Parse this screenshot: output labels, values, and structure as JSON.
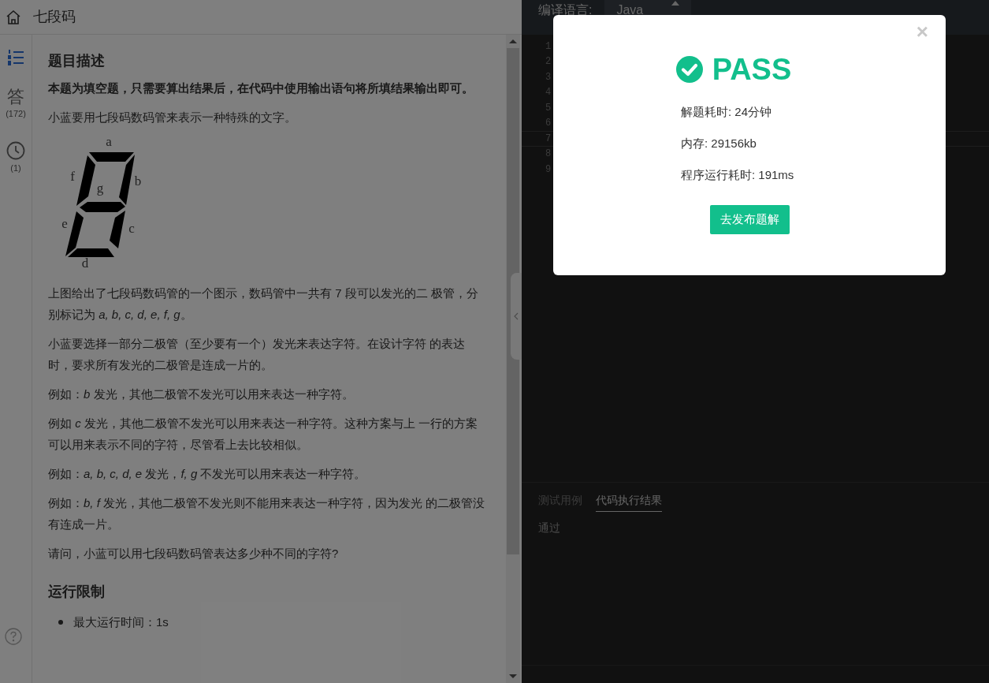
{
  "header": {
    "title": "七段码"
  },
  "sidebar": {
    "items": [
      {
        "kind": "list",
        "selected": true
      },
      {
        "kind": "answers",
        "glyph": "答",
        "count": "(172)",
        "selected": false
      },
      {
        "kind": "history",
        "count": "(1)",
        "selected": false
      }
    ]
  },
  "problem": {
    "sections": [
      {
        "heading": "题目描述",
        "blocks": [
          {
            "kind": "bold",
            "text": "本题为填空题，只需要算出结果后，在代码中使用输出语句将所填结果输出即可。"
          },
          {
            "kind": "text",
            "text": "小蓝要用七段码数码管来表示一种特殊的文字。"
          },
          {
            "kind": "figure",
            "labels": [
              "a",
              "b",
              "c",
              "d",
              "e",
              "f",
              "g"
            ]
          },
          {
            "kind": "text",
            "text": "上图给出了七段码数码管的一个图示，数码管中一共有 7 段可以发光的二 极管，分别标记为 *a, b, c, d, e, f, g*。"
          },
          {
            "kind": "text",
            "text": "小蓝要选择一部分二极管（至少要有一个）发光来表达字符。在设计字符 的表达时，要求所有发光的二极管是连成一片的。"
          },
          {
            "kind": "text",
            "text": "例如：*b* 发光，其他二极管不发光可以用来表达一种字符。"
          },
          {
            "kind": "text",
            "text": "例如 *c* 发光，其他二极管不发光可以用来表达一种字符。这种方案与上 一行的方案可以用来表示不同的字符，尽管看上去比较相似。"
          },
          {
            "kind": "text",
            "text": "例如：*a, b, c, d, e* 发光，*f, g* 不发光可以用来表达一种字符。"
          },
          {
            "kind": "text",
            "text": "例如：*b, f* 发光，其他二极管不发光则不能用来表达一种字符，因为发光 的二极管没有连成一片。"
          },
          {
            "kind": "text",
            "text": "请问，小蓝可以用七段码数码管表达多少种不同的字符?"
          }
        ]
      },
      {
        "heading": "运行限制",
        "blocks": [
          {
            "kind": "bullet",
            "text": "最大运行时间：1s"
          }
        ]
      }
    ]
  },
  "editor": {
    "language_label": "编译语言:",
    "language": "Java",
    "lines": [
      {
        "number": "1",
        "active": false
      },
      {
        "number": "2",
        "active": false
      },
      {
        "number": "3",
        "active": false
      },
      {
        "number": "4",
        "active": false
      },
      {
        "number": "5",
        "active": false
      },
      {
        "number": "6",
        "active": false
      },
      {
        "number": "7",
        "active": true
      },
      {
        "number": "8",
        "active": false
      },
      {
        "number": "9",
        "active": false
      }
    ]
  },
  "result_panel": {
    "tabs": [
      {
        "label": "测试用例",
        "selected": false
      },
      {
        "label": "代码执行结果",
        "selected": true
      }
    ],
    "output": "通过"
  },
  "modal": {
    "close": "×",
    "status": "PASS",
    "stats": [
      "解题耗时: 24分钟",
      "内存: 29156kb",
      "程序运行耗时: 191ms"
    ],
    "button": "去发布题解"
  }
}
